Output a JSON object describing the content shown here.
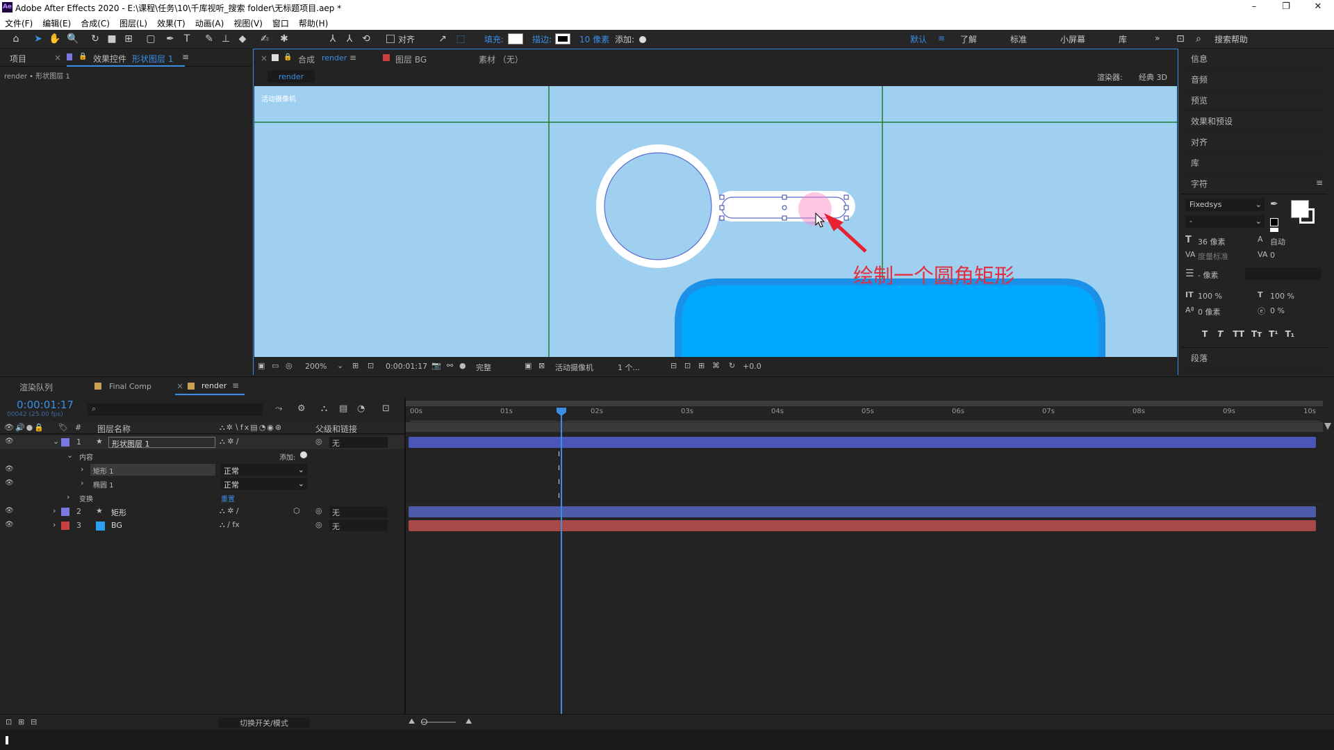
{
  "app": {
    "title": "Adobe After Effects 2020 - E:\\课程\\任务\\10\\千库视听_搜索 folder\\无标题项目.aep *",
    "logo": "Ae",
    "window_buttons": [
      "–",
      "❐",
      "✕"
    ]
  },
  "menu": [
    "文件(F)",
    "编辑(E)",
    "合成(C)",
    "图层(L)",
    "效果(T)",
    "动画(A)",
    "视图(V)",
    "窗口",
    "帮助(H)"
  ],
  "toolbar": {
    "align_label": "对齐",
    "fill_label": "填充:",
    "stroke_label": "描边:",
    "stroke_width": "10 像素",
    "add_label": "添加:",
    "workspaces": [
      "默认",
      "了解",
      "标准",
      "小屏幕",
      "库"
    ],
    "search_help": "搜索帮助"
  },
  "left_panel": {
    "tab_project": "项目",
    "tab_effects": "效果控件",
    "tab_effects_layer": "形状图层 1",
    "breadcrumb": "render • 形状图层 1"
  },
  "comp_panel": {
    "tab_comp_prefix": "合成",
    "tab_comp_name": "render",
    "tab_layer": "图层 BG",
    "tab_footage": "素材 （无）",
    "sub_tab": "render",
    "renderer_label": "渲染器:",
    "renderer_value": "经典 3D",
    "camera_label": "活动摄像机",
    "annotation": "绘制一个圆角矩形",
    "footer": {
      "zoom": "200%",
      "time": "0:00:01:17",
      "resolution": "完整",
      "camera": "活动摄像机",
      "views": "1 个...",
      "exposure": "+0.0"
    }
  },
  "right_panel": {
    "items": [
      "信息",
      "音频",
      "预览",
      "效果和预设",
      "对齐",
      "库"
    ],
    "char_title": "字符",
    "font": "Fixedsys",
    "font_style": "-",
    "font_size": "36 像素",
    "leading": "自动",
    "kerning": "度量标准",
    "tracking": "0",
    "stroke_size": "- 像素",
    "vscale": "100 %",
    "hscale": "100 %",
    "baseline": "0 像素",
    "tsume": "0 %",
    "para_title": "段落",
    "text_styles": [
      "T",
      "T",
      "TT",
      "Tт",
      "T¹",
      "T₁"
    ]
  },
  "timeline": {
    "tabs": [
      "渲染队列",
      "Final Comp",
      "render"
    ],
    "timecode": "0:00:01:17",
    "frameinfo": "00042 (25.00 fps)",
    "col_name": "图层名称",
    "col_parent": "父级和链接",
    "ruler": [
      "00s",
      "01s",
      "02s",
      "03s",
      "04s",
      "05s",
      "06s",
      "07s",
      "08s",
      "09s",
      "10s"
    ],
    "layers": [
      {
        "num": "1",
        "name": "形状图层 1",
        "color": "#7878e0",
        "parent": "无",
        "bar": "#4a57b8"
      },
      {
        "num": "2",
        "name": "矩形",
        "color": "#7878e0",
        "parent": "无",
        "bar": "#4c5aa8"
      },
      {
        "num": "3",
        "name": "BG",
        "color": "#c84040",
        "parent": "无",
        "bar": "#a84848"
      }
    ],
    "contents_label": "内容",
    "add_label": "添加:",
    "sub_rect": "矩形 1",
    "sub_ellipse": "椭圆 1",
    "mode_normal": "正常",
    "transform_label": "变换",
    "reset_label": "重置",
    "toggle_label": "切换开关/模式"
  },
  "colors": {
    "accent": "#3a8ee6",
    "canvas_bg": "#a0d0f0",
    "guide": "#1e7a3a",
    "annotation": "#e03040",
    "cyan_shape": "#00a8ff"
  }
}
